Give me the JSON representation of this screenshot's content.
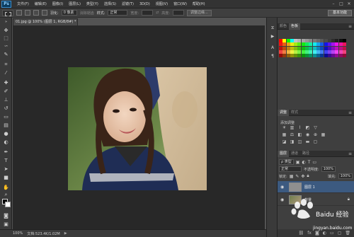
{
  "menubar": {
    "logo": "Ps",
    "items": [
      "文件(F)",
      "编辑(E)",
      "图像(I)",
      "图层(L)",
      "类型(Y)",
      "选择(S)",
      "滤镜(T)",
      "3D(D)",
      "视图(V)",
      "窗口(W)",
      "帮助(H)"
    ],
    "window_buttons": [
      "–",
      "□",
      "✕"
    ]
  },
  "options": {
    "feather_label": "羽化:",
    "feather_value": "0 像素",
    "antialias_label": "消除锯齿",
    "style_label": "样式:",
    "style_value": "正常",
    "width_label": "宽度:",
    "height_label": "高度:",
    "refine_edge": "调整边缘...",
    "workspace": "基本功能"
  },
  "document": {
    "tab_title": "01.jpg @ 100% (图层 1, RGB/8#) *",
    "close": "×"
  },
  "status": {
    "zoom": "100%",
    "doc_info": "文档:523.4K/1.02M",
    "arrow": "▶"
  },
  "panels": {
    "color_tabs": [
      "颜色",
      "色板"
    ],
    "adjust_tabs": [
      "调整",
      "样式"
    ],
    "adjust_title": "添加调整",
    "layers_tabs": [
      "图层",
      "通道",
      "路径"
    ],
    "kind_label": "ρ 类型",
    "blend_mode": "正常",
    "opacity_label": "不透明度:",
    "opacity_value": "100%",
    "lock_label": "锁定:",
    "fill_label": "填充:",
    "fill_value": "100%",
    "layers": [
      {
        "name": "图层 1",
        "selected": true
      },
      {
        "name": "背景",
        "selected": false
      }
    ],
    "menu_icon": "≡"
  },
  "watermark": "Baidu 经验",
  "watermark_url": "jingyan.baidu.com",
  "colors": {
    "ui_dark": "#282828",
    "panel": "#3f3f3f",
    "selection": "#3c5a80"
  }
}
